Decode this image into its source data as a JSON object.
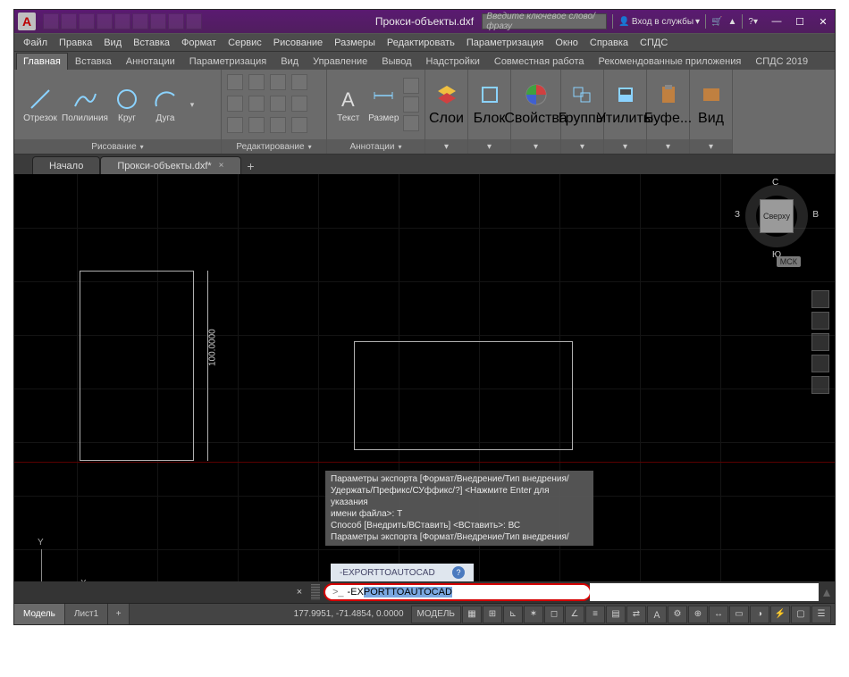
{
  "titlebar": {
    "app_initial": "A",
    "doc_title": "Прокси-объекты.dxf",
    "search_placeholder": "Введите ключевое слово/фразу",
    "signin": "Вход в службы",
    "min": "—",
    "max": "☐",
    "close": "✕"
  },
  "menubar": [
    "Файл",
    "Правка",
    "Вид",
    "Вставка",
    "Формат",
    "Сервис",
    "Рисование",
    "Размеры",
    "Редактировать",
    "Параметризация",
    "Окно",
    "Справка",
    "СПДС"
  ],
  "ribbon_tabs": [
    "Главная",
    "Вставка",
    "Аннотации",
    "Параметризация",
    "Вид",
    "Управление",
    "Вывод",
    "Надстройки",
    "Совместная работа",
    "Рекомендованные приложения",
    "СПДС 2019"
  ],
  "ribbon": {
    "draw": {
      "title": "Рисование",
      "tools": [
        {
          "label": "Отрезок"
        },
        {
          "label": "Полилиния"
        },
        {
          "label": "Круг"
        },
        {
          "label": "Дуга"
        }
      ]
    },
    "modify": {
      "title": "Редактирование"
    },
    "annotate": {
      "title": "Аннотации",
      "tools": [
        {
          "label": "Текст"
        },
        {
          "label": "Размер"
        }
      ]
    },
    "layers": {
      "title": "Слои"
    },
    "block": {
      "title": "Блок"
    },
    "props": {
      "title": "Свойства"
    },
    "groups": {
      "title": "Группы"
    },
    "utils": {
      "title": "Утилиты"
    },
    "clipboard": {
      "title": "Буфе..."
    },
    "view": {
      "title": "Вид"
    }
  },
  "file_tabs": {
    "start": "Начало",
    "active": "Прокси-объекты.dxf*",
    "close": "×",
    "add": "+"
  },
  "canvas": {
    "dim_label": "100.0000",
    "ucs_x": "X",
    "ucs_y": "Y",
    "cube_face": "Сверху",
    "cube_n": "С",
    "cube_s": "Ю",
    "cube_e": "В",
    "cube_w": "З",
    "msk": "МСК"
  },
  "cmd": {
    "history_line1": "Параметры экспорта [Формат/Внедрение/Тип внедрения/",
    "history_line2": "Удержать/Префикс/СУффикс/?] <Нажмите Enter для указания",
    "history_line3": "имени файла>: Т",
    "history_line4": "Способ [Внедрить/ВСтавить] <ВСтавить>: ВС",
    "history_line5": "Параметры экспорта [Формат/Внедрение/Тип внедрения/",
    "suggest": "-EXPORTTOAUTOCAD",
    "q": "?",
    "prompt_icon": ">_",
    "typed": "-EX",
    "completion": "PORTTOAUTOCAD",
    "close": "×",
    "up": "▴"
  },
  "status": {
    "tab_model": "Модель",
    "tab_sheet": "Лист1",
    "sheet_add": "+",
    "coords": "177.9951, -71.4854, 0.0000",
    "model_btn": "МОДЕЛЬ"
  }
}
